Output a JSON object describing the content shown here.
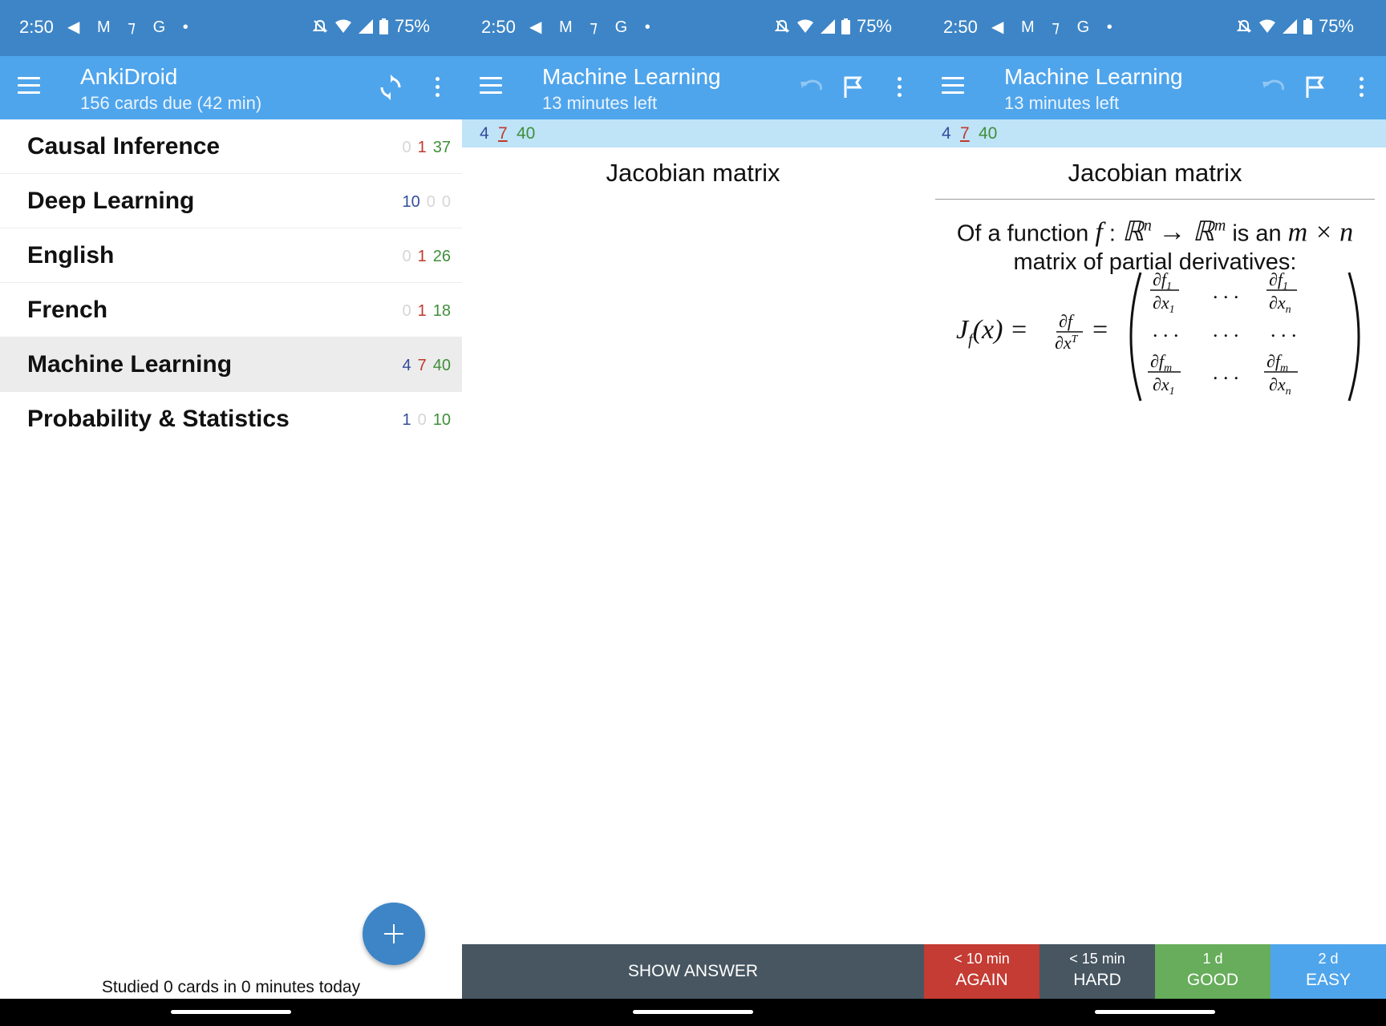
{
  "status_bar": {
    "time": "2:50",
    "notif_icons": "◀ M ⁊ G •",
    "battery": "75%"
  },
  "panel1": {
    "title": "AnkiDroid",
    "subtitle": "156 cards due (42 min)",
    "decks": [
      {
        "name": "Causal Inference",
        "new": "0",
        "learn": "1",
        "review": "37"
      },
      {
        "name": "Deep Learning",
        "new": "10",
        "learn": "0",
        "review": "0"
      },
      {
        "name": "English",
        "new": "0",
        "learn": "1",
        "review": "26"
      },
      {
        "name": "French",
        "new": "0",
        "learn": "1",
        "review": "18"
      },
      {
        "name": "Machine Learning",
        "new": "4",
        "learn": "7",
        "review": "40"
      },
      {
        "name": "Probability & Statistics",
        "new": "1",
        "learn": "0",
        "review": "10"
      }
    ],
    "footer": "Studied 0 cards in 0 minutes today"
  },
  "reviewer": {
    "title": "Machine Learning",
    "subtitle": "13 minutes left",
    "counts": {
      "new": "4",
      "learn": "7",
      "review": "40"
    },
    "question": "Jacobian matrix",
    "answer_line1_pre": "Of a function",
    "answer_line1_post": "is an",
    "answer_line2": "matrix of partial derivatives:",
    "show_answer": "SHOW ANSWER",
    "ease_buttons": [
      {
        "time": "< 10 min",
        "label": "AGAIN",
        "color": "#c43c33"
      },
      {
        "time": "< 15 min",
        "label": "HARD",
        "color": "#475661"
      },
      {
        "time": "1 d",
        "label": "GOOD",
        "color": "#67ad5b"
      },
      {
        "time": "2 d",
        "label": "EASY",
        "color": "#4fa5ec"
      }
    ]
  },
  "colors": {
    "status_bar": "#3d85c6",
    "app_bar": "#4fa5ec",
    "counts_bar": "#bfe3f7",
    "new_count": "#334d9c",
    "learn_count": "#c0392b",
    "review_count": "#3f8f3a"
  }
}
